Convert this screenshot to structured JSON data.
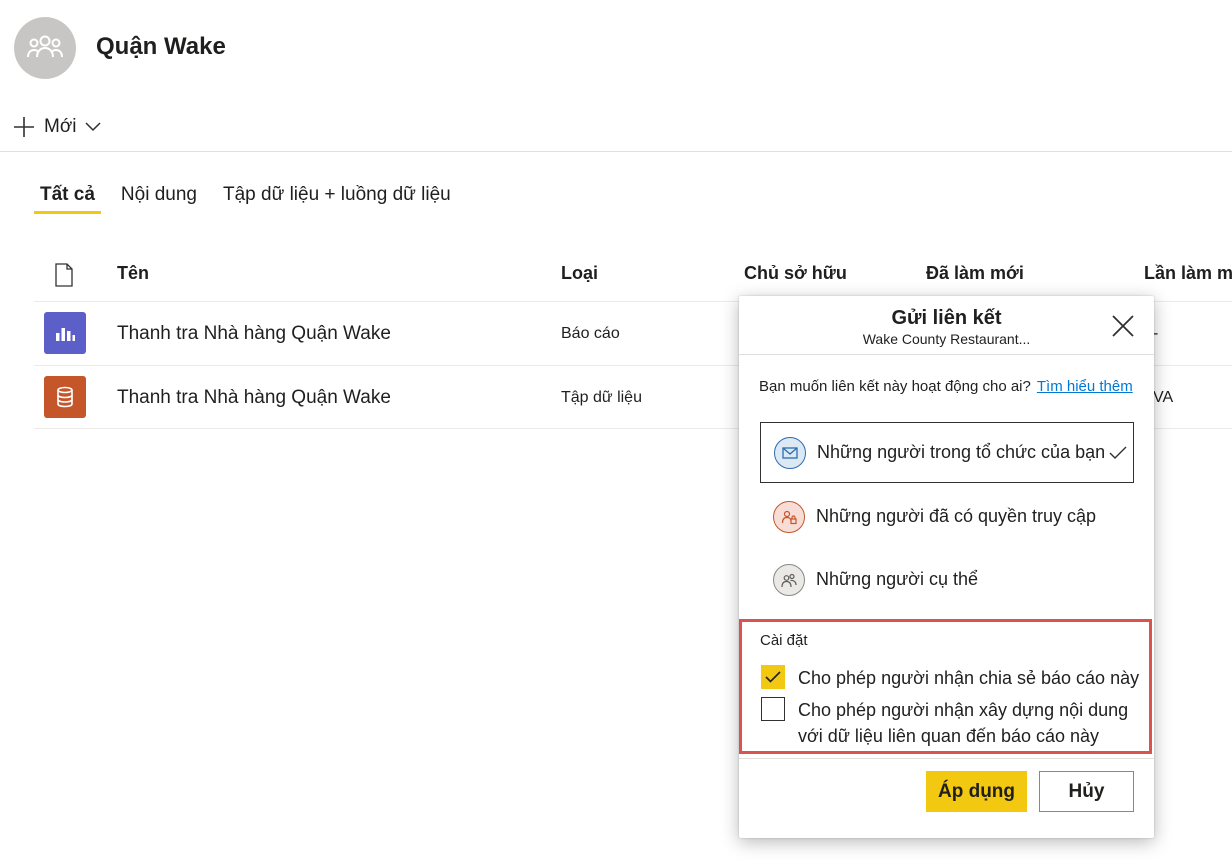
{
  "workspace": {
    "title": "Quận Wake",
    "icon": "group-icon"
  },
  "toolbar": {
    "new_label": "Mới"
  },
  "tabs": [
    {
      "label": "Tất cả",
      "active": true
    },
    {
      "label": "Nội dung",
      "active": false
    },
    {
      "label": "Tập dữ liệu + luồng dữ liệu",
      "active": false
    }
  ],
  "table": {
    "columns": [
      "Tên",
      "Loại",
      "Chủ sở hữu",
      "Đã làm mới",
      "Lần làm mới"
    ],
    "rows": [
      {
        "icon": "report-icon",
        "icon_color": "#5b5fc7",
        "name": "Thanh tra Nhà hàng Quận Wake",
        "type": "Báo cáo",
        "peek": "-"
      },
      {
        "icon": "dataset-icon",
        "icon_color": "#c4562a",
        "name": "Thanh tra Nhà hàng Quận Wake",
        "type": "Tập dữ liệu",
        "peek": "VA"
      }
    ]
  },
  "dialog": {
    "title": "Gửi liên kết",
    "subtitle": "Wake County Restaurant...",
    "question": "Bạn muốn liên kết này hoạt động cho ai?",
    "learn_more": "Tìm hiểu thêm",
    "options": [
      {
        "label": "Những người trong tổ chức của bạn",
        "selected": true,
        "icon": "organization-icon"
      },
      {
        "label": "Những người đã có quyền truy cập",
        "selected": false,
        "icon": "existing-access-icon"
      },
      {
        "label": "Những người cụ thể",
        "selected": false,
        "icon": "specific-people-icon"
      }
    ],
    "settings": {
      "title": "Cài đặt",
      "items": [
        {
          "label": "Cho phép người nhận chia sẻ báo cáo này",
          "checked": true
        },
        {
          "label": "Cho phép người nhận xây dựng nội dung với dữ liệu liên quan đến báo cáo này",
          "checked": false
        }
      ]
    },
    "apply_label": "Áp dụng",
    "cancel_label": "Hủy"
  },
  "colors": {
    "accent": "#f2c811",
    "link": "#0078d4",
    "highlight": "#d9534f"
  }
}
